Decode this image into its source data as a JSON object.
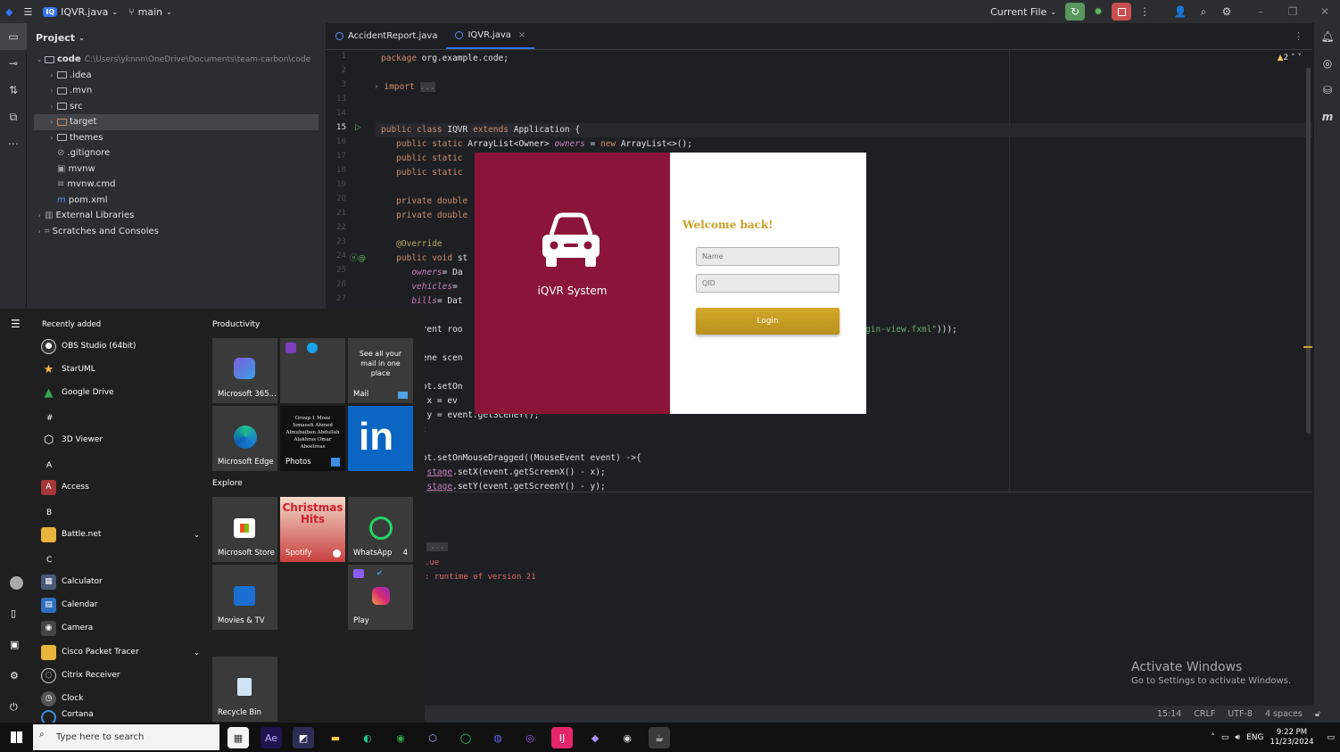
{
  "topbar": {
    "project_badge": "IQ",
    "project_name": "IQVR.java",
    "branch": "main",
    "run_config": "Current File"
  },
  "project_panel": {
    "title": "Project",
    "root_name": "code",
    "root_path": "C:\\Users\\yknnn\\OneDrive\\Documents\\team-carbon\\code",
    "items": [
      ".idea",
      ".mvn",
      "src",
      "target",
      "themes",
      ".gitignore",
      "mvnw",
      "mvnw.cmd",
      "pom.xml",
      "External Libraries",
      "Scratches and Consoles"
    ]
  },
  "editor": {
    "tabs": [
      "AccidentReport.java",
      "IQVR.java"
    ],
    "warnings": "2",
    "line_numbers": [
      "1",
      "2",
      "3",
      "13",
      "14",
      "15",
      "16",
      "17",
      "18",
      "19",
      "20",
      "21",
      "22",
      "23",
      "24",
      "25",
      "26",
      "27"
    ]
  },
  "console": {
    "l1": "...",
    "l2": ".ue",
    "l3": ": runtime of version 21"
  },
  "login": {
    "brand": "iQVR System",
    "welcome": "Welcome back!",
    "name_placeholder": "Name",
    "qid_placeholder": "QID",
    "login_label": "Login"
  },
  "start_menu": {
    "recently_added": "Recently added",
    "productivity": "Productivity",
    "explore": "Explore",
    "apps": {
      "obs": "OBS Studio (64bit)",
      "staruml": "StarUML",
      "gdrive": "Google Drive",
      "hash": "#",
      "viewer3d": "3D Viewer",
      "a": "A",
      "access": "Access",
      "b": "B",
      "battlenet": "Battle.net",
      "c": "C",
      "calculator": "Calculator",
      "calendar": "Calendar",
      "camera": "Camera",
      "cisco": "Cisco Packet Tracer",
      "citrix": "Citrix Receiver",
      "clock": "Clock",
      "cortana": "Cortana"
    },
    "tiles": {
      "m365": "Microsoft 365...",
      "mail_text": "See all your mail in one place",
      "mail": "Mail",
      "edge": "Microsoft Edge",
      "photos": "Photos",
      "photo_text": "Group 1 Moaz Ismaeeh Ahmed Almuhaiban Abdullah Alakhras Omar Aboelreas",
      "store": "Microsoft Store",
      "spotify_title": "Christmas Hits",
      "spotify": "Spotify",
      "whatsapp": "WhatsApp",
      "whatsapp_count": "4",
      "movies": "Movies & TV",
      "play": "Play",
      "recycle": "Recycle Bin",
      "linkedin": "in"
    }
  },
  "statusbar": {
    "pos": "15:14",
    "eol": "CRLF",
    "enc": "UTF-8",
    "indent": "4 spaces"
  },
  "activate": {
    "title": "Activate Windows",
    "sub": "Go to Settings to activate Windows."
  },
  "taskbar": {
    "search_placeholder": "Type here to search",
    "lang": "ENG",
    "time": "9:22 PM",
    "date": "11/23/2024"
  }
}
